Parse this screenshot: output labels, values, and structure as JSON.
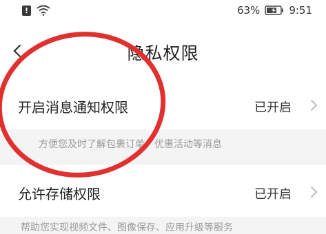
{
  "status_bar": {
    "battery_percent": "63%",
    "time": "9:51",
    "notification_badge": "!"
  },
  "header": {
    "title": "隐私权限",
    "back_icon": "chevron-left-icon"
  },
  "permissions": [
    {
      "label": "开启消息通知权限",
      "status": "已开启",
      "description": "方便您及时了解包裹订单、优惠活动等消息"
    },
    {
      "label": "允许存储权限",
      "status": "已开启",
      "description": "帮助您实现视频文件、图像保存、应用升级等服务"
    }
  ],
  "colors": {
    "annotation": "#e0312f",
    "background": "#f4f4f4",
    "card": "#ffffff"
  }
}
